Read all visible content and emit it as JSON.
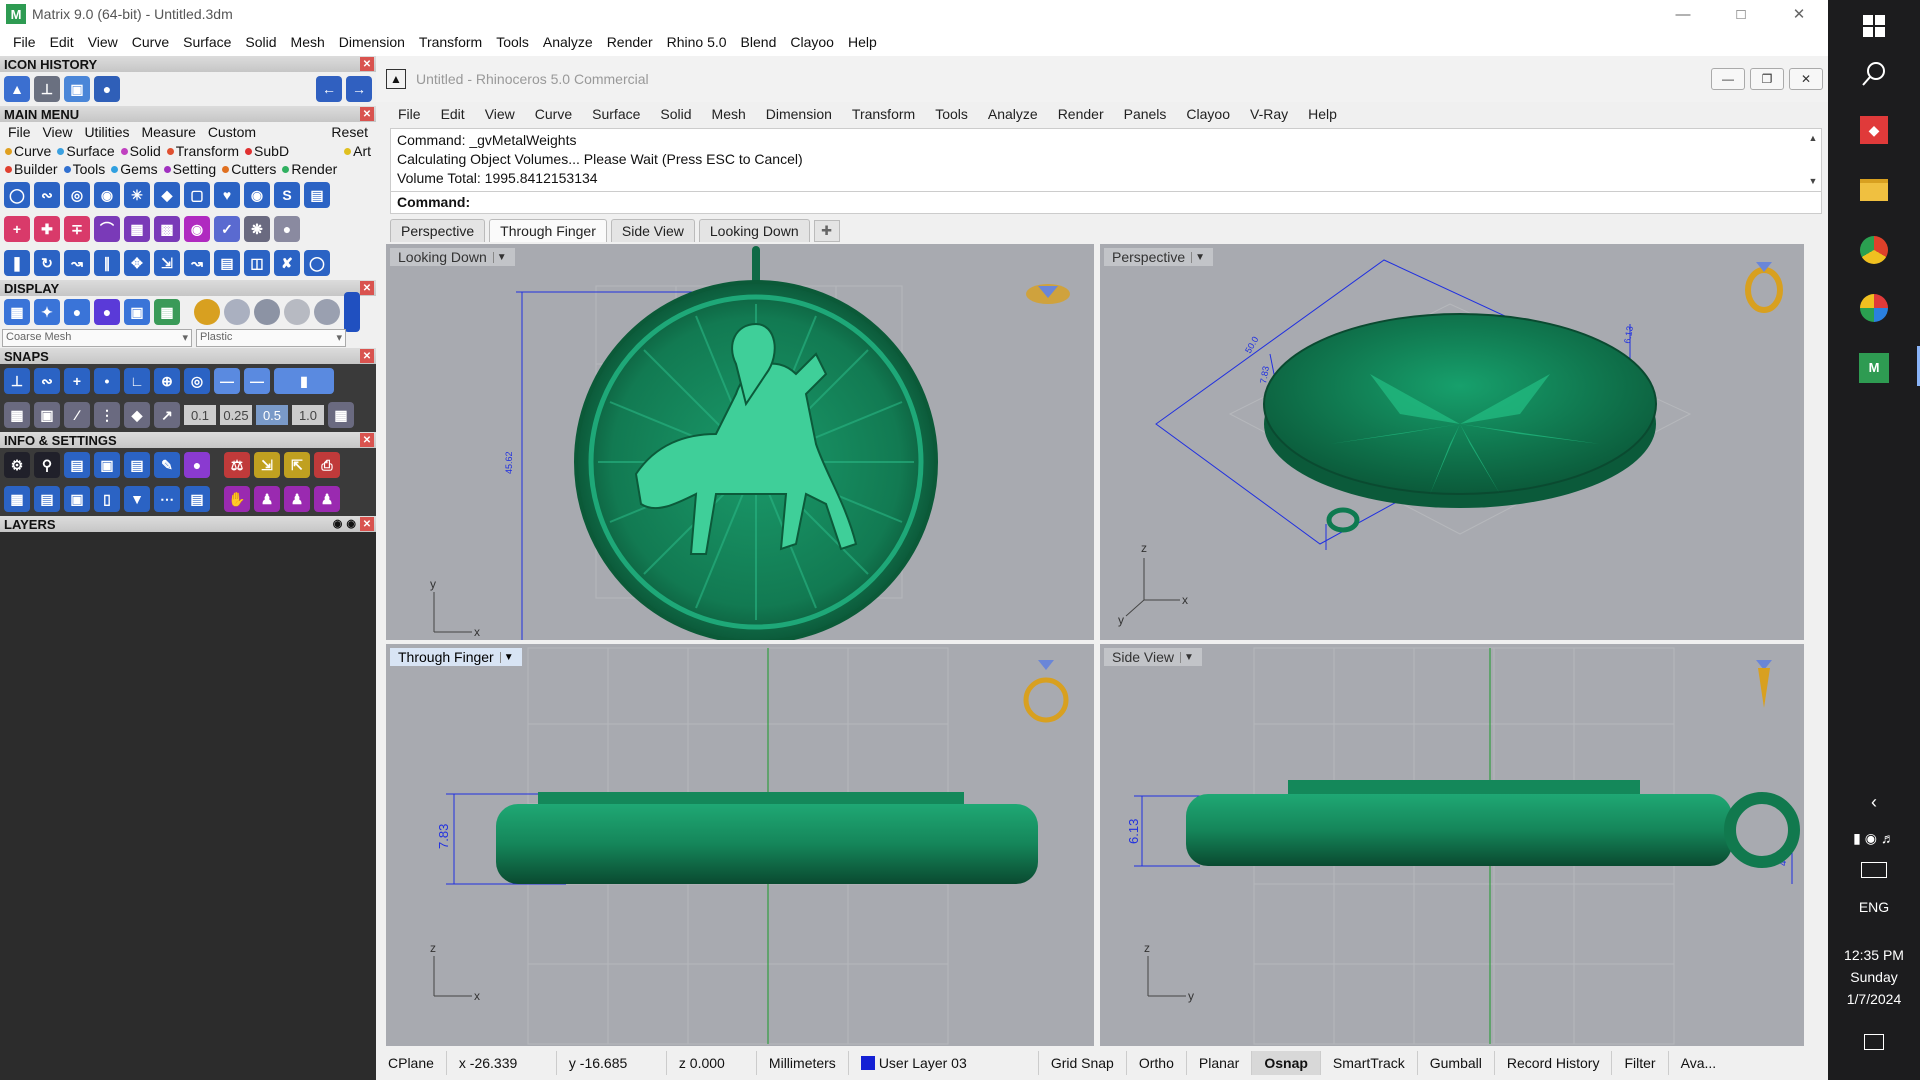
{
  "app": {
    "title": "Matrix 9.0 (64-bit) - Untitled.3dm",
    "menu": [
      "File",
      "Edit",
      "View",
      "Curve",
      "Surface",
      "Solid",
      "Mesh",
      "Dimension",
      "Transform",
      "Tools",
      "Analyze",
      "Render",
      "Rhino 5.0",
      "Blend",
      "Clayoo",
      "Help"
    ]
  },
  "left_panel": {
    "icon_history": "ICON HISTORY",
    "main_menu": {
      "title": "MAIN MENU",
      "items": [
        "File",
        "View",
        "Utilities",
        "Measure",
        "Custom"
      ],
      "reset": "Reset",
      "cats_row1": [
        "Curve",
        "Surface",
        "Solid",
        "Transform",
        "SubD",
        "Art"
      ],
      "cats_row2": [
        "Builder",
        "Tools",
        "Gems",
        "Setting",
        "Cutters",
        "Render"
      ]
    },
    "display": {
      "title": "DISPLAY",
      "mesh": "Coarse Mesh",
      "material": "Plastic"
    },
    "snaps": {
      "title": "SNAPS",
      "values": [
        "0.1",
        "0.25",
        "0.5",
        "1.0"
      ]
    },
    "info": "INFO & SETTINGS",
    "layers": "LAYERS"
  },
  "rhino": {
    "title": "Untitled - Rhinoceros 5.0 Commercial",
    "menu": [
      "File",
      "Edit",
      "View",
      "Curve",
      "Surface",
      "Solid",
      "Mesh",
      "Dimension",
      "Transform",
      "Tools",
      "Analyze",
      "Render",
      "Panels",
      "Clayoo",
      "V-Ray",
      "Help"
    ],
    "command_history": [
      "Command: _gvMetalWeights",
      "Calculating Object Volumes... Please Wait (Press ESC to Cancel)",
      "Volume Total: 1995.8412153134"
    ],
    "command_prompt": "Command:",
    "tabs": [
      "Perspective",
      "Through Finger",
      "Side View",
      "Looking Down"
    ],
    "active_tab": "Through Finger",
    "viewports": {
      "top_left": {
        "label": "Looking Down",
        "dim": "45.62",
        "axis_v": "y",
        "axis_h": "x"
      },
      "top_right": {
        "label": "Perspective",
        "dim_a": "50.0",
        "dim_b": "7.83",
        "dim_c": "6.13",
        "axis_v": "z",
        "axis_l": "y",
        "axis_h": "x"
      },
      "bottom_left": {
        "label": "Through Finger",
        "dim": "7.83",
        "axis_v": "z",
        "axis_h": "x"
      },
      "bottom_right": {
        "label": "Side View",
        "dim": "6.13",
        "dim_r": "4.8",
        "axis_v": "z",
        "axis_h": "y"
      }
    }
  },
  "status": {
    "cplane": "CPlane",
    "x": "x -26.339",
    "y": "y -16.685",
    "z": "z 0.000",
    "units": "Millimeters",
    "layer": "User Layer 03",
    "layer_color": "#1420d4",
    "toggles": [
      "Grid Snap",
      "Ortho",
      "Planar",
      "Osnap",
      "SmartTrack",
      "Gumball",
      "Record History",
      "Filter",
      "Ava..."
    ],
    "active_toggle": "Osnap"
  },
  "tray": {
    "lang": "ENG",
    "time": "12:35 PM",
    "day": "Sunday",
    "date": "1/7/2024"
  }
}
